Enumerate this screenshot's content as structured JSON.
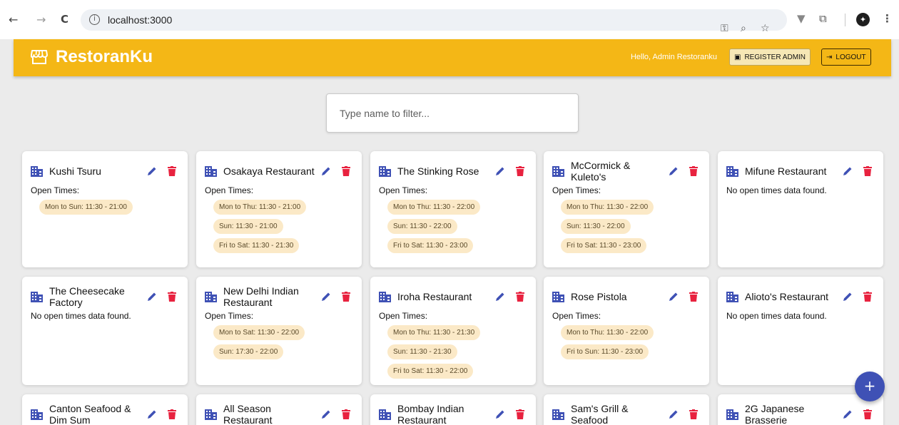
{
  "browser": {
    "back": "←",
    "forward": "→",
    "reload": "C",
    "url": "localhost:3000",
    "info_glyph": "i",
    "icons": [
      "key-icon",
      "zoom-icon",
      "star-icon",
      "extension-filter-icon",
      "puzzle-icon",
      "profile-icon",
      "more-icon"
    ]
  },
  "app": {
    "title": "RestoranKu",
    "greeting": "Hello, Admin Restoranku",
    "register_label": "REGISTER ADMIN",
    "logout_label": "LOGOUT",
    "accent_color": "#f4b716",
    "fab_label": "+"
  },
  "filter": {
    "placeholder": "Type name to filter...",
    "value": ""
  },
  "labels": {
    "open_times": "Open Times:",
    "no_data": "No open times data found."
  },
  "restaurants": [
    {
      "name": "Kushi Tsuru",
      "times": [
        "Mon to Sun: 11:30 - 21:00"
      ]
    },
    {
      "name": "Osakaya Restaurant",
      "times": [
        "Mon to Thu: 11:30 - 21:00",
        "Sun: 11:30 - 21:00",
        "Fri to Sat: 11:30 - 21:30"
      ]
    },
    {
      "name": "The Stinking Rose",
      "times": [
        "Mon to Thu: 11:30 - 22:00",
        "Sun: 11:30 - 22:00",
        "Fri to Sat: 11:30 - 23:00"
      ]
    },
    {
      "name": "McCormick & Kuleto's",
      "times": [
        "Mon to Thu: 11:30 - 22:00",
        "Sun: 11:30 - 22:00",
        "Fri to Sat: 11:30 - 23:00"
      ]
    },
    {
      "name": "Mifune Restaurant",
      "times": []
    },
    {
      "name": "The Cheesecake Factory",
      "times": []
    },
    {
      "name": "New Delhi Indian Restaurant",
      "times": [
        "Mon to Sat: 11:30 - 22:00",
        "Sun: 17:30 - 22:00"
      ]
    },
    {
      "name": "Iroha Restaurant",
      "times": [
        "Mon to Thu: 11:30 - 21:30",
        "Sun: 11:30 - 21:30",
        "Fri to Sat: 11:30 - 22:00"
      ]
    },
    {
      "name": "Rose Pistola",
      "times": [
        "Mon to Thu: 11:30 - 22:00",
        "Fri to Sun: 11:30 - 23:00"
      ]
    },
    {
      "name": "Alioto's Restaurant",
      "times": []
    },
    {
      "name": "Canton Seafood & Dim Sum",
      "times": []
    },
    {
      "name": "All Season Restaurant",
      "times": []
    },
    {
      "name": "Bombay Indian Restaurant",
      "times": []
    },
    {
      "name": "Sam's Grill & Seafood",
      "times": []
    },
    {
      "name": "2G Japanese Brasserie",
      "times": []
    }
  ]
}
